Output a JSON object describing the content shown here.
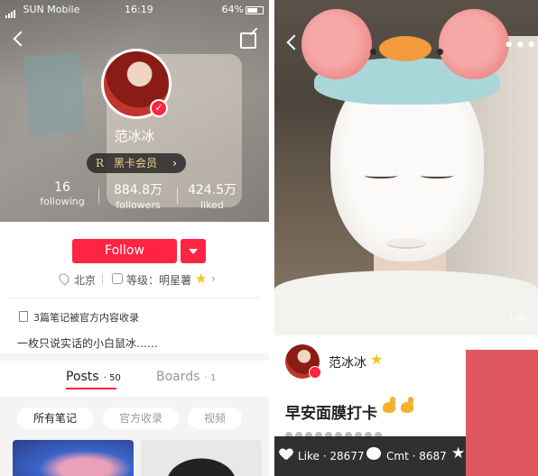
{
  "statusbar": {
    "carrier": "SUN Mobile",
    "time": "16:19",
    "battery": "64%"
  },
  "profile": {
    "username": "范冰冰",
    "vip_label": "黑卡会员",
    "vip_letter": "R",
    "stats": [
      {
        "value": "16",
        "label": "following"
      },
      {
        "value": "884.8万",
        "label": "followers"
      },
      {
        "value": "424.5万",
        "label": "liked"
      }
    ],
    "follow_label": "Follow",
    "location": "北京",
    "level_text": "等级：明星薯",
    "notes_included": "3篇笔记被官方内容收录",
    "bio": "一枚只说实话的小白鼠冰……",
    "tabs": [
      {
        "label": "Posts",
        "count": "50"
      },
      {
        "label": "Boards",
        "count": "1"
      }
    ],
    "filters": [
      "所有笔记",
      "官方收录",
      "视频"
    ]
  },
  "note": {
    "page_indicator": "1/4",
    "author": "范冰冰",
    "title": "早安面膜打卡",
    "actions": {
      "like_label": "Like",
      "like_count": "28677",
      "comment_label": "Cmt",
      "comment_count": "8687"
    }
  },
  "colors": {
    "brand_red": "#ff2442",
    "gold_star": "#f5c518",
    "side_block": "#e0585f"
  },
  "icons": [
    "back-icon",
    "share-icon",
    "verified-icon",
    "location-icon",
    "level-icon",
    "star-icon",
    "note-icon",
    "more-icon",
    "heart-icon",
    "comment-icon"
  ]
}
